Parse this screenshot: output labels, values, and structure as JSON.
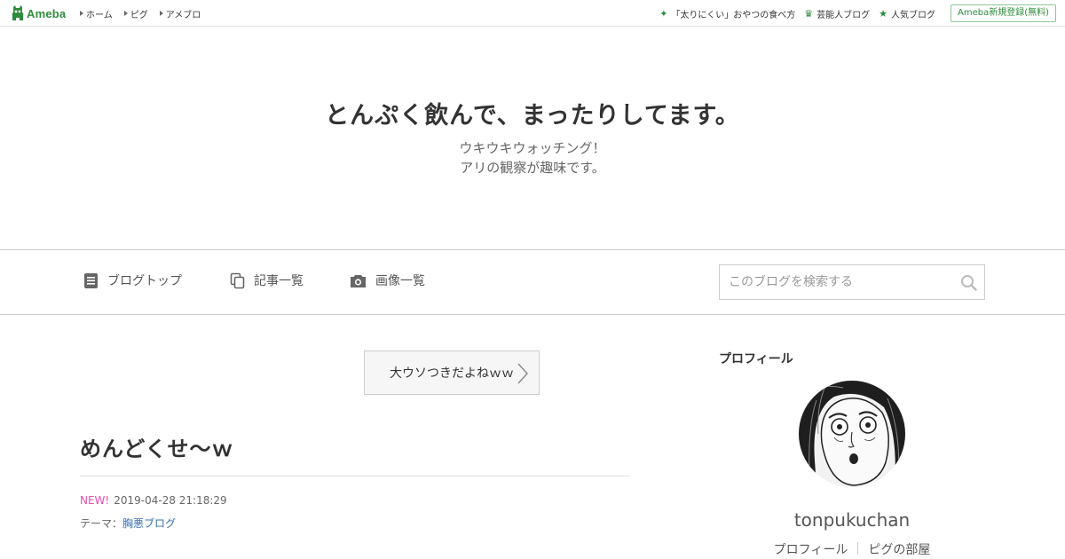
{
  "topbar": {
    "logo_text": "Ameba",
    "nav_left": [
      {
        "label": "ホーム"
      },
      {
        "label": "ピグ"
      },
      {
        "label": "アメブロ"
      }
    ],
    "nav_right": [
      {
        "label": "「太りにくい」おやつの食べ方",
        "icon": "sparkle-icon"
      },
      {
        "label": "芸能人ブログ",
        "icon": "crown-icon"
      },
      {
        "label": "人気ブログ",
        "icon": "star-icon"
      }
    ],
    "signup_label": "Ameba新規登録(無料)"
  },
  "header": {
    "title": "とんぷく飲んで、まったりしてます。",
    "description_lines": [
      "ウキウキウォッチング！",
      "アリの観察が趣味です。"
    ]
  },
  "navband": {
    "items": [
      {
        "label": "ブログトップ",
        "icon": "document-icon"
      },
      {
        "label": "記事一覧",
        "icon": "copy-icon"
      },
      {
        "label": "画像一覧",
        "icon": "camera-icon"
      }
    ],
    "search_placeholder": "このブログを検索する"
  },
  "main": {
    "prev_entry_label": "大ウソつきだよねｗｗ",
    "entry": {
      "title": "めんどくせ～ｗ",
      "new_label": "NEW!",
      "date": "2019-04-28 21:18:29",
      "theme_prefix": "テーマ：",
      "theme_name": "胸悪ブログ"
    }
  },
  "sidebar": {
    "heading": "プロフィール",
    "username": "tonpukuchan",
    "links": [
      {
        "label": "プロフィール"
      },
      {
        "label": "ピグの部屋"
      }
    ]
  },
  "colors": {
    "brand_green": "#2d8c3c",
    "new_badge": "#e34db3",
    "theme_link": "#3a6fb5"
  }
}
